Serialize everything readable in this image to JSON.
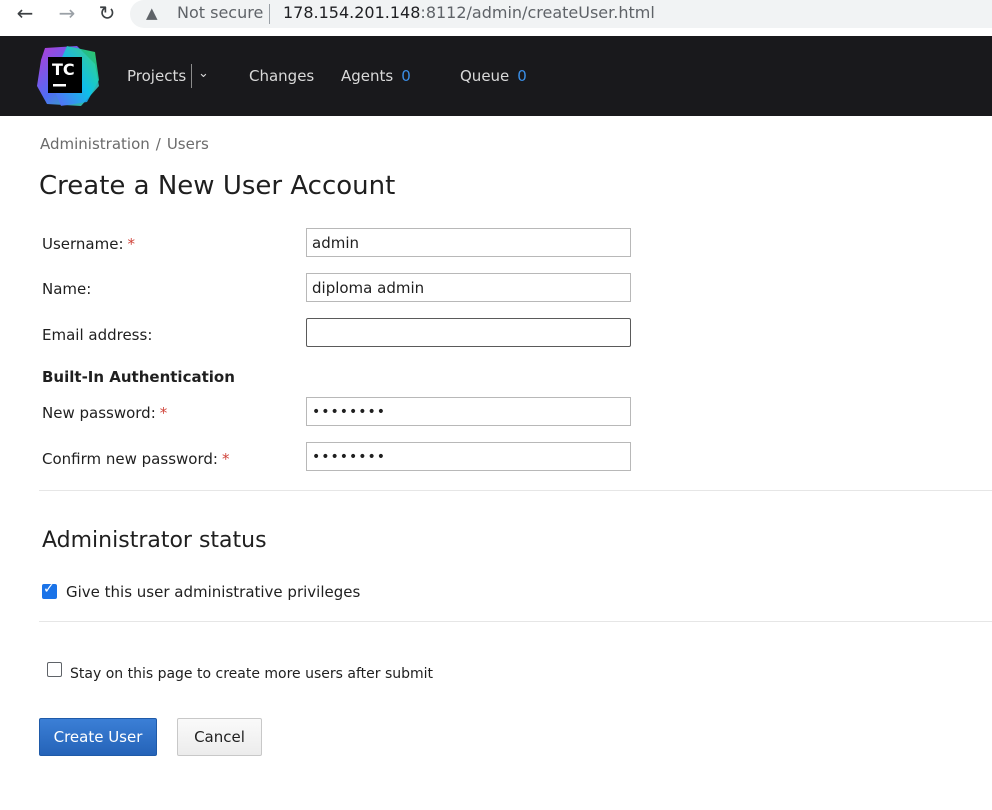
{
  "browser": {
    "security_label": "Not secure",
    "url_host": "178.154.201.148",
    "url_path": ":8112/admin/createUser.html"
  },
  "header": {
    "logo_text": "TC",
    "nav": {
      "projects": "Projects",
      "changes": "Changes",
      "agents": "Agents",
      "agents_count": "0",
      "queue": "Queue",
      "queue_count": "0"
    }
  },
  "breadcrumb": {
    "parent": "Administration",
    "separator": "/",
    "current": "Users"
  },
  "page_title": "Create a New User Account",
  "form": {
    "username": {
      "label": "Username:",
      "required": "*",
      "value": "admin"
    },
    "name": {
      "label": "Name:",
      "value": "diploma admin"
    },
    "email": {
      "label": "Email address:",
      "value": ""
    },
    "auth_section": "Built-In Authentication",
    "new_password": {
      "label": "New password:",
      "required": "*",
      "masked": "••••••••"
    },
    "confirm_password": {
      "label": "Confirm new password:",
      "required": "*",
      "masked": "••••••••"
    }
  },
  "admin_status": {
    "heading": "Administrator status",
    "privileges_label": "Give this user administrative privileges",
    "privileges_checked": true
  },
  "stay_on_page": {
    "label": "Stay on this page to create more users after submit",
    "checked": false
  },
  "buttons": {
    "create": "Create User",
    "cancel": "Cancel"
  },
  "colors": {
    "header_bg": "#19191c",
    "accent": "#3a8ee6",
    "primary_button": "#2a6cc4",
    "required": "#d0443b"
  }
}
